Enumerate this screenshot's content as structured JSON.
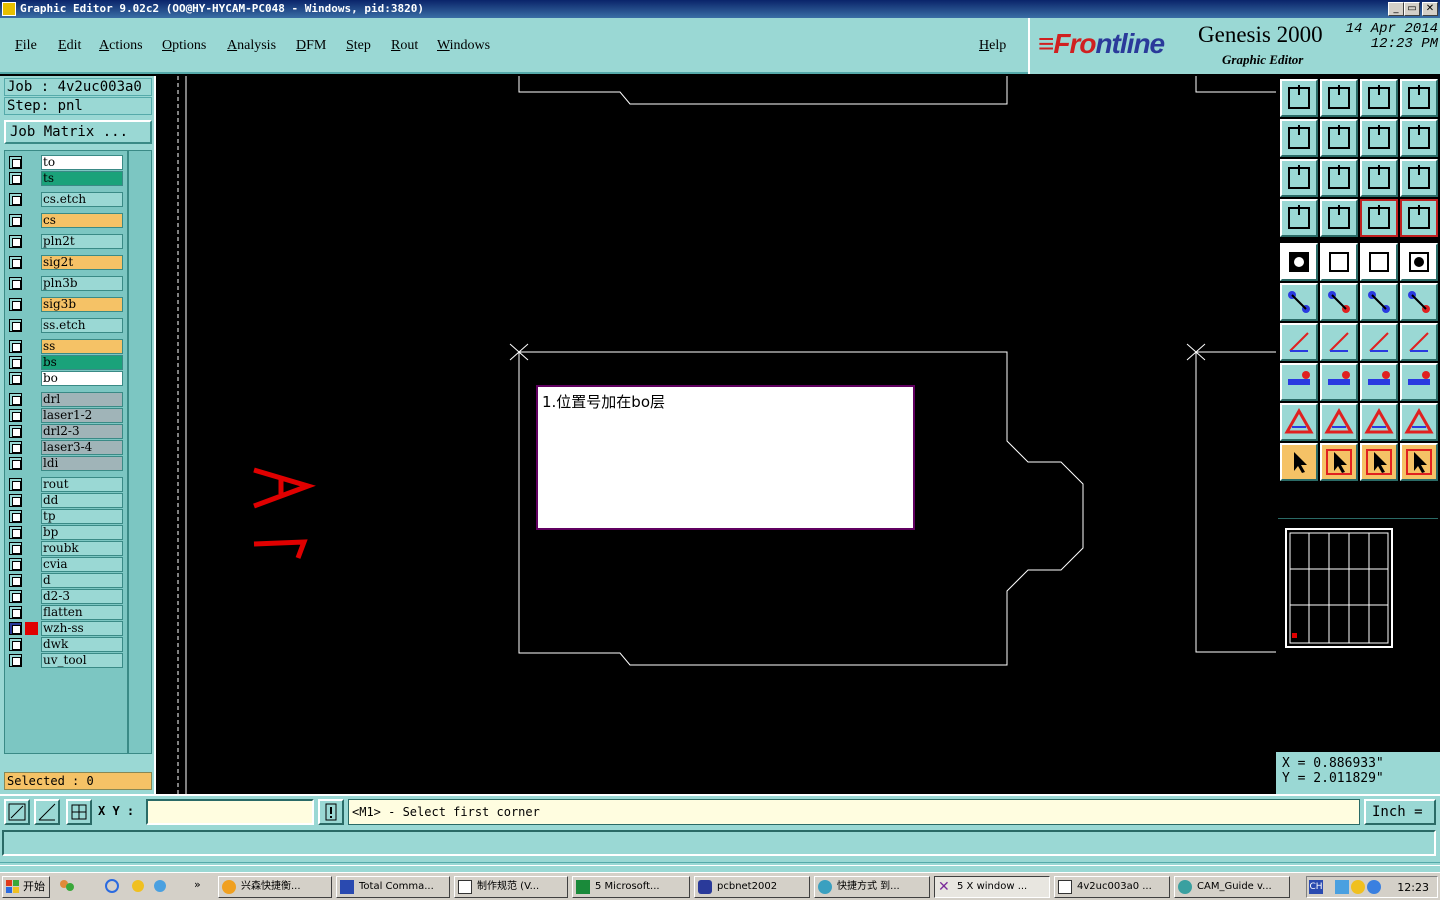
{
  "window": {
    "title": "Graphic Editor 9.02c2 (OO@HY-HYCAM-PC048 - Windows, pid:3820)",
    "buttons": [
      "_",
      "▭",
      "✕"
    ]
  },
  "menu": [
    "File",
    "Edit",
    "Actions",
    "Options",
    "Analysis",
    "DFM",
    "Step",
    "Rout",
    "Windows"
  ],
  "help": "Help",
  "brand": {
    "logo_a": "≡Fr",
    "logo_o": "o",
    "logo_b": "ntline",
    "product": "Genesis 2000",
    "subtitle": "Graphic Editor",
    "date": "14 Apr 2014",
    "time": "12:23 PM"
  },
  "job": "Job : 4v2uc003a0",
  "step": "Step: pnl",
  "job_matrix": "Job Matrix ...",
  "layers": [
    {
      "name": "to",
      "color": "#ffffff"
    },
    {
      "name": "ts",
      "color": "#1aa27a"
    },
    {
      "name": "cs.etch",
      "color": "#9ad8d4"
    },
    {
      "name": "cs",
      "color": "#f5c266"
    },
    {
      "name": "pln2t",
      "color": "#9ad8d4"
    },
    {
      "name": "sig2t",
      "color": "#f5c266"
    },
    {
      "name": "pln3b",
      "color": "#9ad8d4"
    },
    {
      "name": "sig3b",
      "color": "#f5c266"
    },
    {
      "name": "ss.etch",
      "color": "#9ad8d4"
    },
    {
      "name": "ss",
      "color": "#f5c266"
    },
    {
      "name": "bs",
      "color": "#1aa27a"
    },
    {
      "name": "bo",
      "color": "#ffffff"
    },
    {
      "name": "drl",
      "color": "#a0b4b8"
    },
    {
      "name": "laser1-2",
      "color": "#a0b4b8"
    },
    {
      "name": "drl2-3",
      "color": "#a0b4b8"
    },
    {
      "name": "laser3-4",
      "color": "#a0b4b8"
    },
    {
      "name": "ldi",
      "color": "#a0b4b8"
    },
    {
      "name": "rout",
      "color": "#9ad8d4"
    },
    {
      "name": "dd",
      "color": "#9ad8d4"
    },
    {
      "name": "tp",
      "color": "#9ad8d4"
    },
    {
      "name": "bp",
      "color": "#9ad8d4"
    },
    {
      "name": "roubk",
      "color": "#9ad8d4"
    },
    {
      "name": "cvia",
      "color": "#9ad8d4"
    },
    {
      "name": "d",
      "color": "#9ad8d4"
    },
    {
      "name": "d2-3",
      "color": "#9ad8d4"
    },
    {
      "name": "flatten",
      "color": "#9ad8d4"
    },
    {
      "name": "wzh-ss",
      "color": "#9ad8d4",
      "active": true
    },
    {
      "name": "dwk",
      "color": "#9ad8d4"
    },
    {
      "name": "uv_tool",
      "color": "#9ad8d4"
    }
  ],
  "selected": "Selected : 0",
  "note_text": "1.位置号加在bo层",
  "coords": {
    "x": "X = 0.886933\"",
    "y": "Y = 2.011829\""
  },
  "cmd": {
    "xy_label": "X Y :",
    "xy_value": "",
    "prompt": "<M1> - Select first corner",
    "units": "Inch ="
  },
  "taskbar": {
    "start": "开始",
    "tasks": [
      "兴森快捷衡...",
      "Total Comma...",
      "制作规范 (V...",
      "5 Microsoft...",
      "pcbnet2002",
      "快捷方式 到...",
      "5 X window ...",
      "4v2uc003a0 ...",
      "CAM_Guide v..."
    ],
    "clock": "12:23"
  },
  "colors": {
    "panel": "#9ad8d4",
    "accent_yellow": "#f5c266",
    "accent_green": "#1aa27a",
    "canvas": "#000000",
    "profile_line": "#ffffff",
    "annotation_red": "#e00000"
  }
}
